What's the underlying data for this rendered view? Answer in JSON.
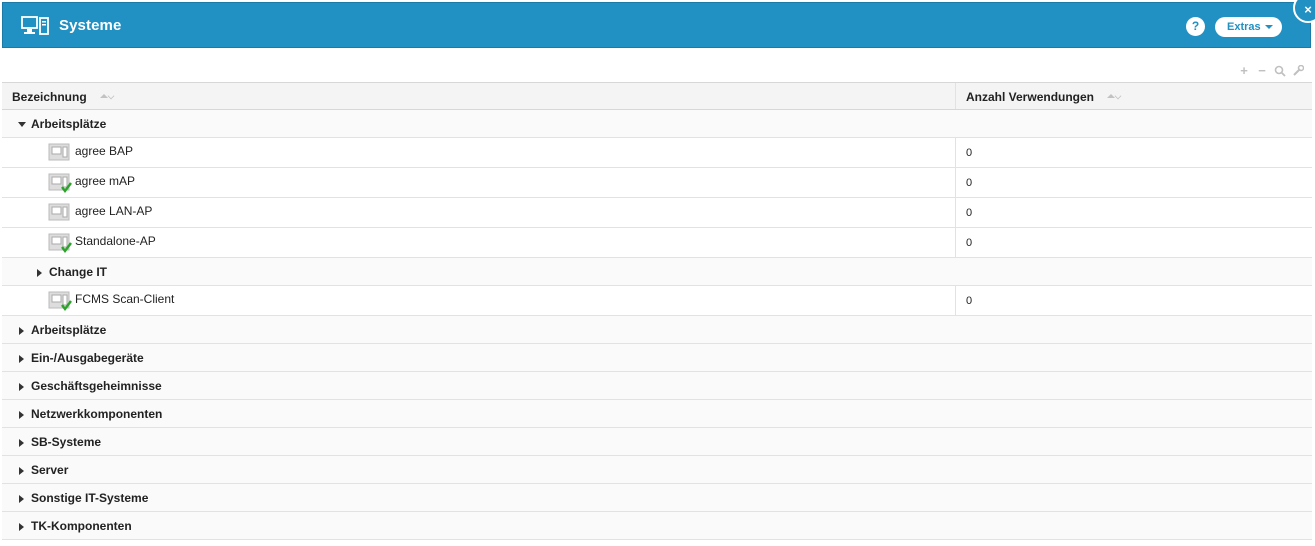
{
  "header": {
    "title": "Systeme",
    "icon": "computer-system-icon",
    "help_label": "?",
    "extras_label": "Extras",
    "close_label": "×",
    "background": "#2190c2"
  },
  "toolbar": {
    "add_label": "+",
    "remove_label": "−",
    "search_label": "⌕",
    "settings_label": "🔧"
  },
  "table": {
    "columns": [
      "Bezeichnung",
      "Anzahl Verwendungen"
    ],
    "expanded_group": {
      "label": "Arbeitsplätze",
      "items": [
        {
          "label": "agree BAP",
          "count": "0",
          "checked": false
        },
        {
          "label": "agree mAP",
          "count": "0",
          "checked": true
        },
        {
          "label": "agree LAN-AP",
          "count": "0",
          "checked": false
        },
        {
          "label": "Standalone-AP",
          "count": "0",
          "checked": true
        }
      ],
      "subgroup": {
        "label": "Change IT",
        "items": [
          {
            "label": "FCMS Scan-Client",
            "count": "0",
            "checked": true
          }
        ]
      }
    },
    "groups": [
      "Arbeitsplätze",
      "Ein-/Ausgabegeräte",
      "Geschäftsgeheimnisse",
      "Netzwerkkomponenten",
      "SB-Systeme",
      "Server",
      "Sonstige IT-Systeme",
      "TK-Komponenten"
    ]
  }
}
